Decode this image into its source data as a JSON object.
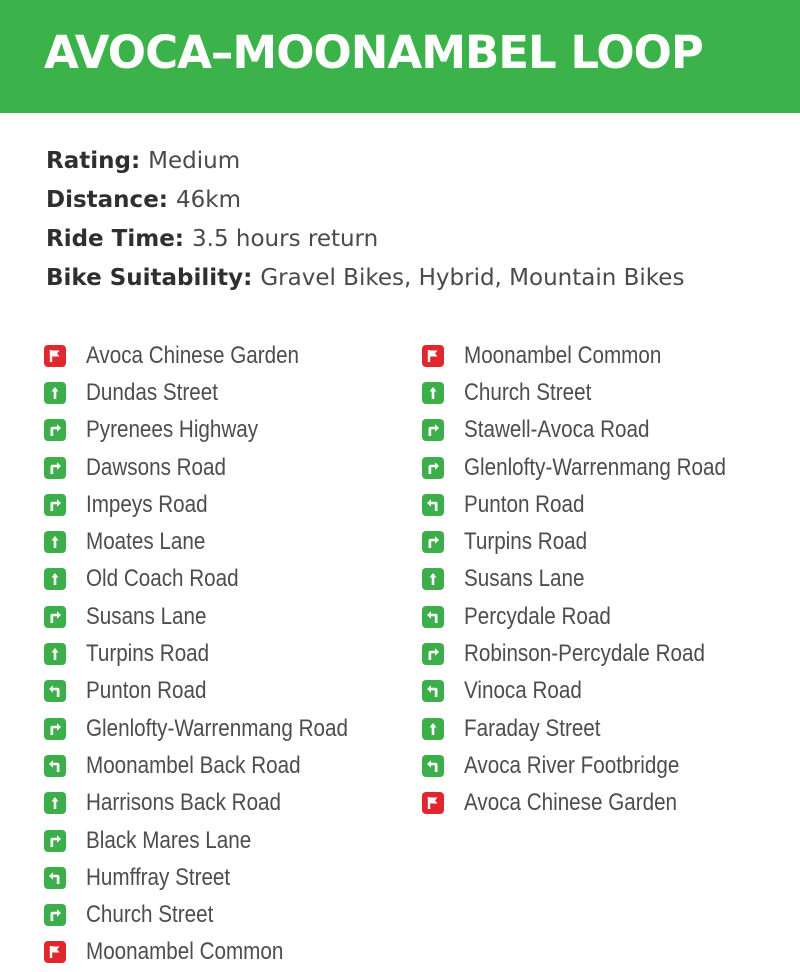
{
  "title": "AVOCA–MOONAMBEL LOOP",
  "colors": {
    "banner": "#3cb34a",
    "turn_icon": "#3cae4a",
    "endpoint_icon": "#e0272e"
  },
  "info": [
    {
      "label": "Rating:",
      "value": "Medium"
    },
    {
      "label": "Distance:",
      "value": "46km"
    },
    {
      "label": "Ride Time:",
      "value": "3.5 hours return"
    },
    {
      "label": "Bike Suitability:",
      "value": "Gravel Bikes, Hybrid, Mountain Bikes"
    }
  ],
  "directions_left": [
    {
      "icon": "flag-icon",
      "label": "Avoca Chinese Garden"
    },
    {
      "icon": "straight-arrow-icon",
      "label": "Dundas Street"
    },
    {
      "icon": "turn-right-icon",
      "label": "Pyrenees Highway"
    },
    {
      "icon": "turn-right-icon",
      "label": "Dawsons Road"
    },
    {
      "icon": "turn-right-icon",
      "label": "Impeys Road"
    },
    {
      "icon": "straight-arrow-icon",
      "label": "Moates Lane"
    },
    {
      "icon": "straight-arrow-icon",
      "label": "Old Coach Road"
    },
    {
      "icon": "turn-right-icon",
      "label": "Susans Lane"
    },
    {
      "icon": "straight-arrow-icon",
      "label": "Turpins Road"
    },
    {
      "icon": "turn-left-icon",
      "label": "Punton Road"
    },
    {
      "icon": "turn-right-icon",
      "label": "Glenlofty-Warrenmang Road"
    },
    {
      "icon": "turn-left-icon",
      "label": "Moonambel Back Road"
    },
    {
      "icon": "straight-arrow-icon",
      "label": "Harrisons Back Road"
    },
    {
      "icon": "turn-right-icon",
      "label": "Black Mares Lane"
    },
    {
      "icon": "turn-left-icon",
      "label": "Humffray Street"
    },
    {
      "icon": "turn-right-icon",
      "label": "Church Street"
    },
    {
      "icon": "flag-icon",
      "label": "Moonambel Common"
    }
  ],
  "directions_right": [
    {
      "icon": "flag-icon",
      "label": "Moonambel Common"
    },
    {
      "icon": "straight-arrow-icon",
      "label": "Church Street"
    },
    {
      "icon": "turn-right-icon",
      "label": "Stawell-Avoca Road"
    },
    {
      "icon": "turn-right-icon",
      "label": "Glenlofty-Warrenmang Road"
    },
    {
      "icon": "turn-left-icon",
      "label": "Punton Road"
    },
    {
      "icon": "turn-right-icon",
      "label": "Turpins Road"
    },
    {
      "icon": "straight-arrow-icon",
      "label": "Susans Lane"
    },
    {
      "icon": "turn-left-icon",
      "label": "Percydale Road"
    },
    {
      "icon": "turn-right-icon",
      "label": "Robinson-Percydale Road"
    },
    {
      "icon": "turn-left-icon",
      "label": "Vinoca Road"
    },
    {
      "icon": "straight-arrow-icon",
      "label": "Faraday Street"
    },
    {
      "icon": "turn-left-icon",
      "label": "Avoca River Footbridge"
    },
    {
      "icon": "flag-icon",
      "label": "Avoca Chinese Garden"
    }
  ]
}
